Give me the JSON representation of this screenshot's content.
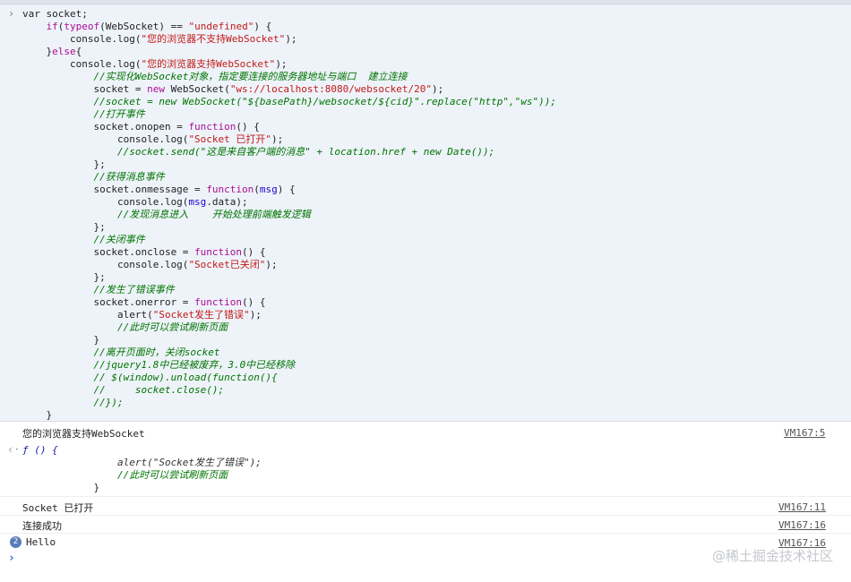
{
  "input": {
    "lines": [
      [
        {
          "t": "var socket;",
          "c": "prop"
        }
      ],
      [
        {
          "t": "    ",
          "c": ""
        },
        {
          "t": "if",
          "c": "kw"
        },
        {
          "t": "(",
          "c": ""
        },
        {
          "t": "typeof",
          "c": "kw"
        },
        {
          "t": "(WebSocket) == ",
          "c": ""
        },
        {
          "t": "\"undefined\"",
          "c": "str"
        },
        {
          "t": ") {",
          "c": ""
        }
      ],
      [
        {
          "t": "        console.log(",
          "c": ""
        },
        {
          "t": "\"您的浏览器不支持WebSocket\"",
          "c": "str"
        },
        {
          "t": ");",
          "c": ""
        }
      ],
      [
        {
          "t": "    }",
          "c": ""
        },
        {
          "t": "else",
          "c": "kw"
        },
        {
          "t": "{",
          "c": ""
        }
      ],
      [
        {
          "t": "        console.log(",
          "c": ""
        },
        {
          "t": "\"您的浏览器支持WebSocket\"",
          "c": "str"
        },
        {
          "t": ");",
          "c": ""
        }
      ],
      [
        {
          "t": "            //实现化WebSocket对象，指定要连接的服务器地址与端口  建立连接",
          "c": "cmt"
        }
      ],
      [
        {
          "t": "            socket = ",
          "c": ""
        },
        {
          "t": "new",
          "c": "kw"
        },
        {
          "t": " WebSocket(",
          "c": ""
        },
        {
          "t": "\"ws://localhost:8080/websocket/20\"",
          "c": "str"
        },
        {
          "t": ");",
          "c": ""
        }
      ],
      [
        {
          "t": "            //socket = new WebSocket(\"${basePath}/websocket/${cid}\".replace(\"http\",\"ws\"));",
          "c": "cmt"
        }
      ],
      [
        {
          "t": "            //打开事件",
          "c": "cmt"
        }
      ],
      [
        {
          "t": "            socket.onopen = ",
          "c": ""
        },
        {
          "t": "function",
          "c": "kw"
        },
        {
          "t": "() {",
          "c": ""
        }
      ],
      [
        {
          "t": "                console.log(",
          "c": ""
        },
        {
          "t": "\"Socket 已打开\"",
          "c": "str"
        },
        {
          "t": ");",
          "c": ""
        }
      ],
      [
        {
          "t": "                //socket.send(\"这是来自客户端的消息\" + location.href + new Date());",
          "c": "cmt"
        }
      ],
      [
        {
          "t": "            };",
          "c": ""
        }
      ],
      [
        {
          "t": "            //获得消息事件",
          "c": "cmt"
        }
      ],
      [
        {
          "t": "            socket.onmessage = ",
          "c": ""
        },
        {
          "t": "function",
          "c": "kw"
        },
        {
          "t": "(",
          "c": ""
        },
        {
          "t": "msg",
          "c": "fn"
        },
        {
          "t": ") {",
          "c": ""
        }
      ],
      [
        {
          "t": "                console.log(",
          "c": ""
        },
        {
          "t": "msg",
          "c": "fn"
        },
        {
          "t": ".data);",
          "c": ""
        }
      ],
      [
        {
          "t": "                //发现消息进入    开始处理前端触发逻辑",
          "c": "cmt"
        }
      ],
      [
        {
          "t": "            };",
          "c": ""
        }
      ],
      [
        {
          "t": "            //关闭事件",
          "c": "cmt"
        }
      ],
      [
        {
          "t": "            socket.onclose = ",
          "c": ""
        },
        {
          "t": "function",
          "c": "kw"
        },
        {
          "t": "() {",
          "c": ""
        }
      ],
      [
        {
          "t": "                console.log(",
          "c": ""
        },
        {
          "t": "\"Socket已关闭\"",
          "c": "str"
        },
        {
          "t": ");",
          "c": ""
        }
      ],
      [
        {
          "t": "            };",
          "c": ""
        }
      ],
      [
        {
          "t": "            //发生了错误事件",
          "c": "cmt"
        }
      ],
      [
        {
          "t": "            socket.onerror = ",
          "c": ""
        },
        {
          "t": "function",
          "c": "kw"
        },
        {
          "t": "() {",
          "c": ""
        }
      ],
      [
        {
          "t": "                alert(",
          "c": ""
        },
        {
          "t": "\"Socket发生了错误\"",
          "c": "str"
        },
        {
          "t": ");",
          "c": ""
        }
      ],
      [
        {
          "t": "                //此时可以尝试刷新页面",
          "c": "cmt"
        }
      ],
      [
        {
          "t": "            }",
          "c": ""
        }
      ],
      [
        {
          "t": "            //离开页面时，关闭socket",
          "c": "cmt"
        }
      ],
      [
        {
          "t": "            //jquery1.8中已经被废弃，3.0中已经移除",
          "c": "cmt"
        }
      ],
      [
        {
          "t": "            // $(window).unload(function(){",
          "c": "cmt"
        }
      ],
      [
        {
          "t": "            //     socket.close();",
          "c": "cmt"
        }
      ],
      [
        {
          "t": "            //});",
          "c": "cmt"
        }
      ],
      [
        {
          "t": "    }",
          "c": ""
        }
      ]
    ]
  },
  "logs": [
    {
      "text": "您的浏览器支持WebSocket",
      "source": "VM167:5"
    },
    {
      "text": "Socket 已打开",
      "source": "VM167:11"
    },
    {
      "text": "连接成功",
      "source": "VM167:16"
    },
    {
      "text": "Hello",
      "source": "VM167:16",
      "count": "2"
    }
  ],
  "return_value": {
    "head": "ƒ () {",
    "line2": "                alert(\"Socket发生了错误\");",
    "line3": "                //此时可以尝试刷新页面",
    "line4": "            }"
  },
  "watermark": "@稀土掘金技术社区"
}
